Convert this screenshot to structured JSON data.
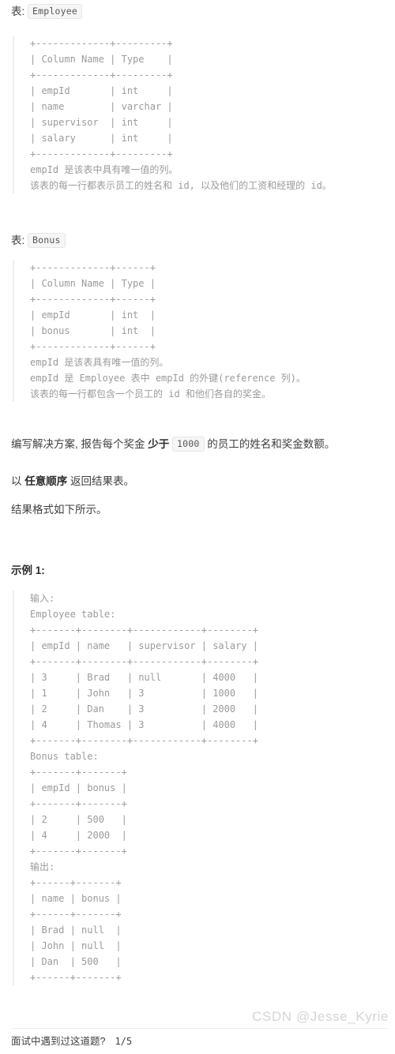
{
  "tables": [
    {
      "label_prefix": "表:",
      "name": "Employee",
      "schema_block": "+-------------+---------+\n| Column Name | Type    |\n+-------------+---------+\n| empId       | int     |\n| name        | varchar |\n| supervisor  | int     |\n| salary      | int     |\n+-------------+---------+",
      "notes": [
        "empId 是该表中具有唯一值的列。",
        "该表的每一行都表示员工的姓名和 id, 以及他们的工资和经理的 id。"
      ]
    },
    {
      "label_prefix": "表:",
      "name": "Bonus",
      "schema_block": "+-------------+------+\n| Column Name | Type |\n+-------------+------+\n| empId       | int  |\n| bonus       | int  |\n+-------------+------+",
      "notes": [
        "empId 是该表具有唯一值的列。",
        "empId 是 Employee 表中 empId 的外键(reference 列)。",
        "该表的每一行都包含一个员工的 id 和他们各自的奖金。"
      ]
    }
  ],
  "prompt": {
    "line1_a": "编写解决方案, 报告每个奖金 ",
    "line1_b": "少于",
    "line1_chip": "1000",
    "line1_c": " 的员工的姓名和奖金数额。",
    "line2_a": "以 ",
    "line2_b": "任意顺序",
    "line2_c": " 返回结果表。",
    "line3": "结果格式如下所示。"
  },
  "example": {
    "heading": "示例 1:",
    "input_label": "输入:",
    "employee_table_label": "Employee table:",
    "employee_table": "+-------+--------+------------+--------+\n| empId | name   | supervisor | salary |\n+-------+--------+------------+--------+\n| 3     | Brad   | null       | 4000   |\n| 1     | John   | 3          | 1000   |\n| 2     | Dan    | 3          | 2000   |\n| 4     | Thomas | 3          | 4000   |\n+-------+--------+------------+--------+",
    "bonus_table_label": "Bonus table:",
    "bonus_table": "+-------+-------+\n| empId | bonus |\n+-------+-------+\n| 2     | 500   |\n| 4     | 2000  |\n+-------+-------+",
    "output_label": "输出:",
    "output_table": "+------+-------+\n| name | bonus |\n+------+-------+\n| Brad | null  |\n| John | null  |\n| Dan  | 500   |\n+------+-------+"
  },
  "footer": {
    "question": "面试中遇到过这道题?",
    "counter": "1/5",
    "watermark": "CSDN @Jesse_Kyrie"
  },
  "colors": {
    "text": "#3f3f3f",
    "code_text": "#9b9b9b",
    "chip_bg": "#f6f6f6",
    "chip_border": "#e6e6e6",
    "rule": "#ececec",
    "watermark": "#d5d5d5",
    "code_bar": "#eeeeee"
  }
}
